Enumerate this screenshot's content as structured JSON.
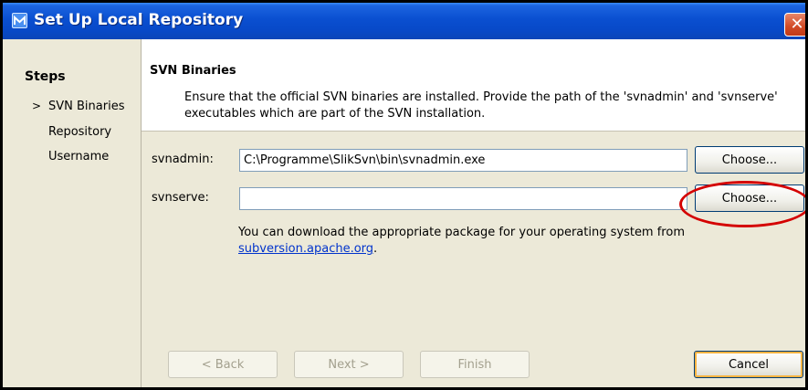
{
  "window": {
    "title": "Set Up Local Repository",
    "close_glyph": "✕"
  },
  "steps": {
    "title": "Steps",
    "current_marker": ">",
    "items": [
      {
        "label": "SVN Binaries",
        "current": true
      },
      {
        "label": "Repository",
        "current": false
      },
      {
        "label": "Username",
        "current": false
      }
    ]
  },
  "panel": {
    "title": "SVN Binaries",
    "description": "Ensure that the official SVN binaries are installed. Provide the path of the 'svnadmin' and 'svnserve' executables which are part of the SVN installation."
  },
  "fields": {
    "svnadmin": {
      "label": "svnadmin:",
      "value": "C:\\Programme\\SlikSvn\\bin\\svnadmin.exe",
      "button": "Choose..."
    },
    "svnserve": {
      "label": "svnserve:",
      "value": "",
      "button": "Choose..."
    }
  },
  "hint": {
    "text": "You can download the appropriate package for your operating system from",
    "link": "subversion.apache.org",
    "suffix": "."
  },
  "buttons": {
    "back": "< Back",
    "next": "Next >",
    "finish": "Finish",
    "cancel": "Cancel"
  },
  "colors": {
    "titlebar": "#0a4fd0",
    "highlight": "#d40000",
    "link": "#0033cc"
  }
}
